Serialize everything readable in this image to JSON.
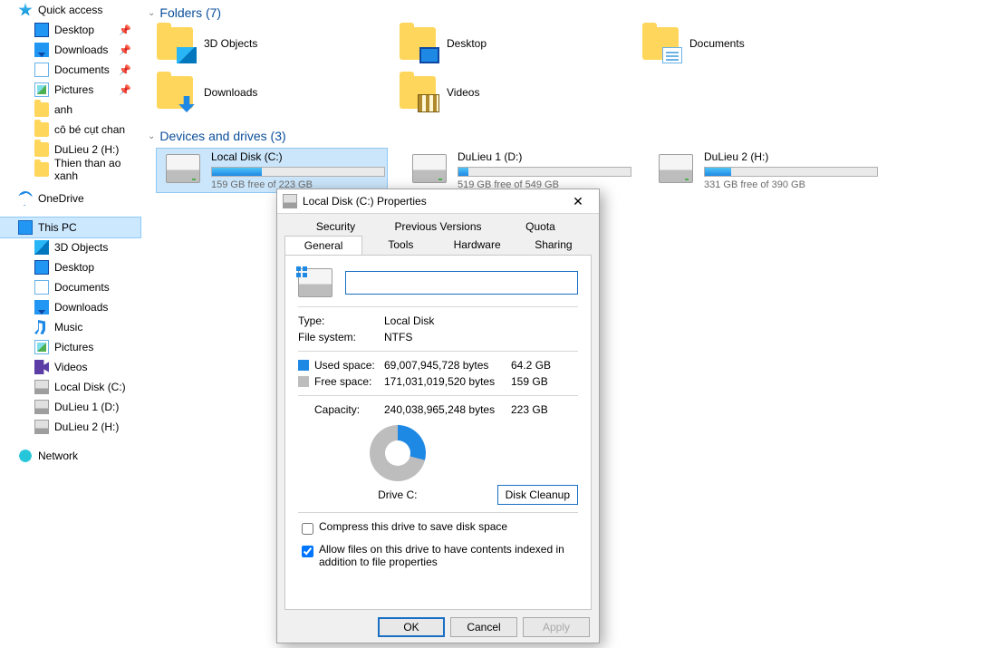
{
  "sidebar": {
    "quick_access": "Quick access",
    "qa_items": [
      {
        "label": "Desktop",
        "pinned": true
      },
      {
        "label": "Downloads",
        "pinned": true
      },
      {
        "label": "Documents",
        "pinned": true
      },
      {
        "label": "Pictures",
        "pinned": true
      },
      {
        "label": "anh",
        "pinned": false
      },
      {
        "label": "cô bé cụt chan",
        "pinned": false
      },
      {
        "label": "DuLieu 2 (H:)",
        "pinned": false
      },
      {
        "label": "Thien than ao xanh",
        "pinned": false
      }
    ],
    "onedrive": "OneDrive",
    "this_pc": "This PC",
    "pc_items": [
      {
        "label": "3D Objects"
      },
      {
        "label": "Desktop"
      },
      {
        "label": "Documents"
      },
      {
        "label": "Downloads"
      },
      {
        "label": "Music"
      },
      {
        "label": "Pictures"
      },
      {
        "label": "Videos"
      },
      {
        "label": "Local Disk (C:)"
      },
      {
        "label": "DuLieu 1 (D:)"
      },
      {
        "label": "DuLieu 2 (H:)"
      }
    ],
    "network": "Network"
  },
  "main": {
    "folders_header": "Folders (7)",
    "folders": [
      {
        "label": "3D Objects"
      },
      {
        "label": "Desktop"
      },
      {
        "label": "Documents"
      },
      {
        "label": "Downloads"
      },
      {
        "label": "Videos"
      }
    ],
    "drives_header": "Devices and drives (3)",
    "drives": [
      {
        "label": "Local Disk (C:)",
        "status": "159 GB free of 223 GB",
        "pct": 29
      },
      {
        "label": "DuLieu 1 (D:)",
        "status": "519 GB free of 549 GB",
        "pct": 6
      },
      {
        "label": "DuLieu 2 (H:)",
        "status": "331 GB free of 390 GB",
        "pct": 15
      }
    ]
  },
  "dialog": {
    "title": "Local Disk (C:) Properties",
    "tabs_row1": [
      "Security",
      "Previous Versions",
      "Quota"
    ],
    "tabs_row2": [
      "General",
      "Tools",
      "Hardware",
      "Sharing"
    ],
    "active_tab": "General",
    "name_value": "",
    "type_label": "Type:",
    "type_value": "Local Disk",
    "fs_label": "File system:",
    "fs_value": "NTFS",
    "used_label": "Used space:",
    "used_bytes": "69,007,945,728 bytes",
    "used_gb": "64.2 GB",
    "free_label": "Free space:",
    "free_bytes": "171,031,019,520 bytes",
    "free_gb": "159 GB",
    "cap_label": "Capacity:",
    "cap_bytes": "240,038,965,248 bytes",
    "cap_gb": "223 GB",
    "drive_label": "Drive C:",
    "cleanup": "Disk Cleanup",
    "compress": "Compress this drive to save disk space",
    "index": "Allow files on this drive to have contents indexed in addition to file properties",
    "ok": "OK",
    "cancel": "Cancel",
    "apply": "Apply"
  },
  "chart_data": {
    "type": "pie",
    "title": "Drive C:",
    "series": [
      {
        "name": "Used space",
        "value_bytes": 69007945728,
        "value_gb": 64.2,
        "color": "#1e88e5"
      },
      {
        "name": "Free space",
        "value_bytes": 171031019520,
        "value_gb": 159,
        "color": "#bdbdbd"
      }
    ],
    "total_bytes": 240038965248,
    "total_gb": 223
  }
}
